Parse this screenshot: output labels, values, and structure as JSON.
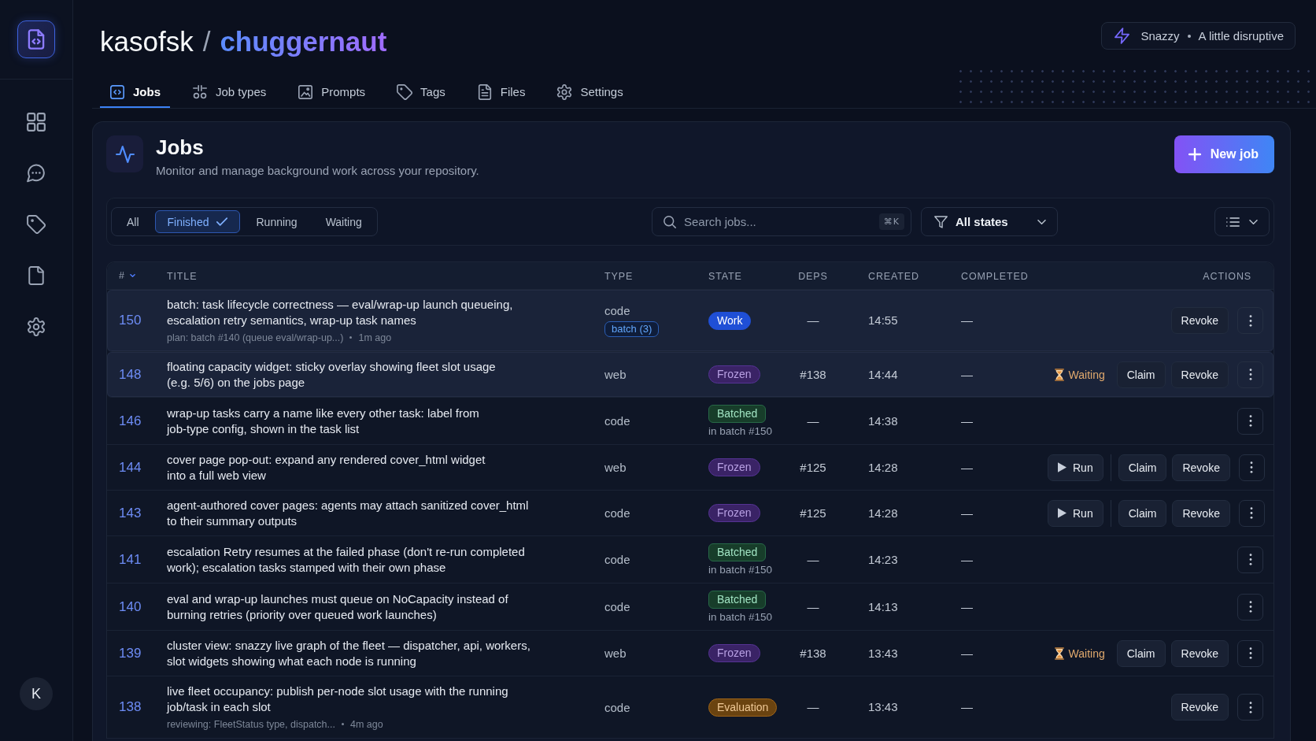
{
  "sidebar": {
    "avatar": "K"
  },
  "header": {
    "owner": "kasofsk",
    "separator": "/",
    "repo": "chuggernaut",
    "mood": {
      "name": "Snazzy",
      "tagline": "A little disruptive"
    }
  },
  "tabs": [
    {
      "label": "Jobs",
      "selected": true
    },
    {
      "label": "Job types",
      "selected": false
    },
    {
      "label": "Prompts",
      "selected": false
    },
    {
      "label": "Tags",
      "selected": false
    },
    {
      "label": "Files",
      "selected": false
    },
    {
      "label": "Settings",
      "selected": false
    }
  ],
  "panel": {
    "title": "Jobs",
    "subtitle": "Monitor and manage background work across your repository.",
    "new_button": "New job",
    "filters": [
      {
        "label": "All",
        "selected": false
      },
      {
        "label": "Finished",
        "selected": true
      },
      {
        "label": "Running",
        "selected": false
      },
      {
        "label": "Waiting",
        "selected": false
      }
    ],
    "search": {
      "placeholder": "Search jobs...",
      "shortcut": "⌘K"
    },
    "state_filter": "All states",
    "table": {
      "columns": [
        {
          "label": "#",
          "sorted": true
        },
        {
          "label": "TITLE",
          "sorted": false
        },
        {
          "label": "TYPE",
          "sorted": false
        },
        {
          "label": "STATE",
          "sorted": false
        },
        {
          "label": "DEPS",
          "sorted": false
        },
        {
          "label": "CREATED",
          "sorted": false
        },
        {
          "label": "COMPLETED",
          "sorted": false
        },
        {
          "label": "ACTIONS",
          "sorted": false
        }
      ],
      "rows": [
        {
          "number": "150",
          "highlighted": true,
          "title": "batch: task lifecycle correctness — eval/wrap-up launch queueing,\nescalation retry semantics, wrap-up task names",
          "note": "plan: batch #140 (queue eval/wrap-up...)",
          "age": "1m ago",
          "type": "code",
          "tag": "batch (3)",
          "state": {
            "label": "Work",
            "color": "#1f4fd6"
          },
          "deps": "—",
          "created": "14:55",
          "completed": "—",
          "actions": [
            {
              "kind": "button",
              "label": "Revoke"
            }
          ]
        },
        {
          "number": "148",
          "highlighted": true,
          "title": "floating capacity widget: sticky overlay showing fleet slot usage\n(e.g. 5/6) on the jobs page",
          "type": "web",
          "state": {
            "label": "Frozen",
            "color": "#3a2366"
          },
          "deps": "#138",
          "created": "14:44",
          "completed": "—",
          "actions": [
            {
              "kind": "status",
              "label": "Waiting"
            },
            {
              "kind": "button",
              "label": "Claim"
            },
            {
              "kind": "button",
              "label": "Revoke"
            }
          ]
        },
        {
          "number": "146",
          "highlighted": false,
          "title": "wrap-up tasks carry a name like every other task: label from\njob-type config, shown in the task list",
          "type": "code",
          "state": {
            "label": "Batched",
            "color": "#173d2a",
            "note": "in batch #150"
          },
          "deps": "—",
          "created": "14:38",
          "completed": "—",
          "actions": []
        },
        {
          "number": "144",
          "highlighted": false,
          "title": "cover page pop-out: expand any rendered cover_html widget\ninto a full web view",
          "type": "web",
          "state": {
            "label": "Frozen",
            "color": "#3a2366"
          },
          "deps": "#125",
          "created": "14:28",
          "completed": "—",
          "actions": [
            {
              "kind": "run",
              "label": "Run"
            },
            {
              "kind": "button",
              "label": "Claim"
            },
            {
              "kind": "button",
              "label": "Revoke"
            }
          ]
        },
        {
          "number": "143",
          "highlighted": false,
          "title": "agent-authored cover pages: agents may attach sanitized cover_html\nto their summary outputs",
          "type": "code",
          "state": {
            "label": "Frozen",
            "color": "#3a2366"
          },
          "deps": "#125",
          "created": "14:28",
          "completed": "—",
          "actions": [
            {
              "kind": "run",
              "label": "Run"
            },
            {
              "kind": "button",
              "label": "Claim"
            },
            {
              "kind": "button",
              "label": "Revoke"
            }
          ]
        },
        {
          "number": "141",
          "highlighted": false,
          "title": "escalation Retry resumes at the failed phase (don't re-run completed\nwork); escalation tasks stamped with their own phase",
          "type": "code",
          "state": {
            "label": "Batched",
            "color": "#173d2a",
            "note": "in batch #150"
          },
          "deps": "—",
          "created": "14:23",
          "completed": "—",
          "actions": []
        },
        {
          "number": "140",
          "highlighted": false,
          "title": "eval and wrap-up launches must queue on NoCapacity instead of\nburning retries (priority over queued work launches)",
          "type": "code",
          "state": {
            "label": "Batched",
            "color": "#173d2a",
            "note": "in batch #150"
          },
          "deps": "—",
          "created": "14:13",
          "completed": "—",
          "actions": []
        },
        {
          "number": "139",
          "highlighted": false,
          "title": "cluster view: snazzy live graph of the fleet — dispatcher, api, workers,\nslot widgets showing what each node is running",
          "type": "web",
          "state": {
            "label": "Frozen",
            "color": "#3a2366"
          },
          "deps": "#138",
          "created": "13:43",
          "completed": "—",
          "actions": [
            {
              "kind": "status",
              "label": "Waiting"
            },
            {
              "kind": "button",
              "label": "Claim"
            },
            {
              "kind": "button",
              "label": "Revoke"
            }
          ]
        },
        {
          "number": "138",
          "highlighted": false,
          "title": "live fleet occupancy: publish per-node slot usage with the running\njob/task in each slot",
          "note": "reviewing: FleetStatus type, dispatch...",
          "age": "4m ago",
          "type": "code",
          "state": {
            "label": "Evaluation",
            "color": "#6a4310"
          },
          "deps": "—",
          "created": "13:43",
          "completed": "—",
          "actions": [
            {
              "kind": "button",
              "label": "Revoke"
            }
          ]
        }
      ]
    }
  }
}
